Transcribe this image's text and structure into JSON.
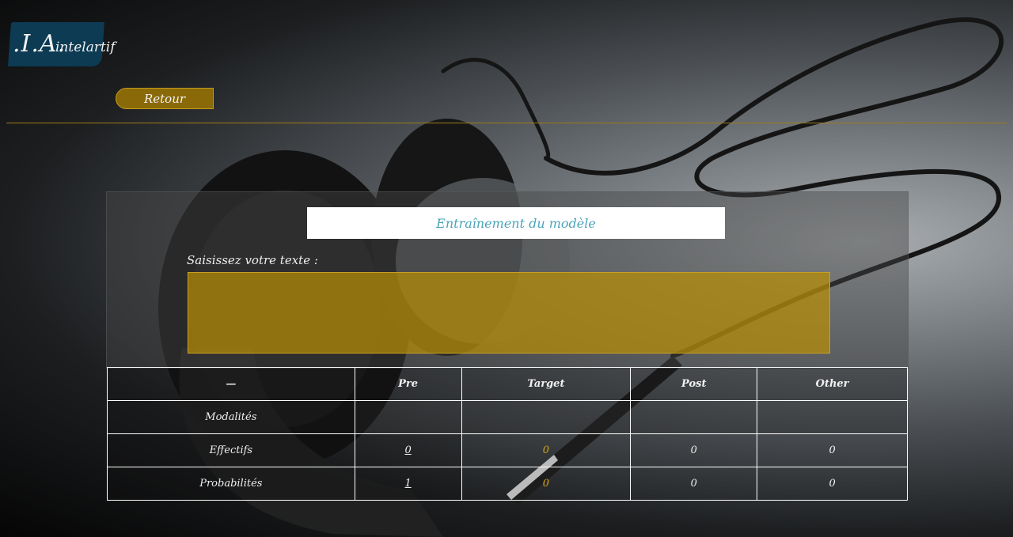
{
  "logo": {
    "mark": ".I.A.",
    "name": "intelartif"
  },
  "back_button": {
    "label": "Retour"
  },
  "page_title": "Entraînement du modèle",
  "input": {
    "label": "Saisissez votre texte :",
    "value": "",
    "placeholder": ""
  },
  "table": {
    "headers": [
      "—",
      "Pre",
      "Target",
      "Post",
      "Other"
    ],
    "rows": [
      {
        "label": "Modalités",
        "pre": "",
        "target": "",
        "post": "",
        "other": ""
      },
      {
        "label": "Effectifs",
        "pre": "0",
        "target": "0",
        "post": "0",
        "other": "0"
      },
      {
        "label": "Probabilités",
        "pre": "1",
        "target": "0",
        "post": "0",
        "other": "0"
      }
    ]
  },
  "colors": {
    "accent_gold": "#b88e06",
    "title_teal": "#4aa3b8",
    "logo_blue": "#0d3b53"
  }
}
